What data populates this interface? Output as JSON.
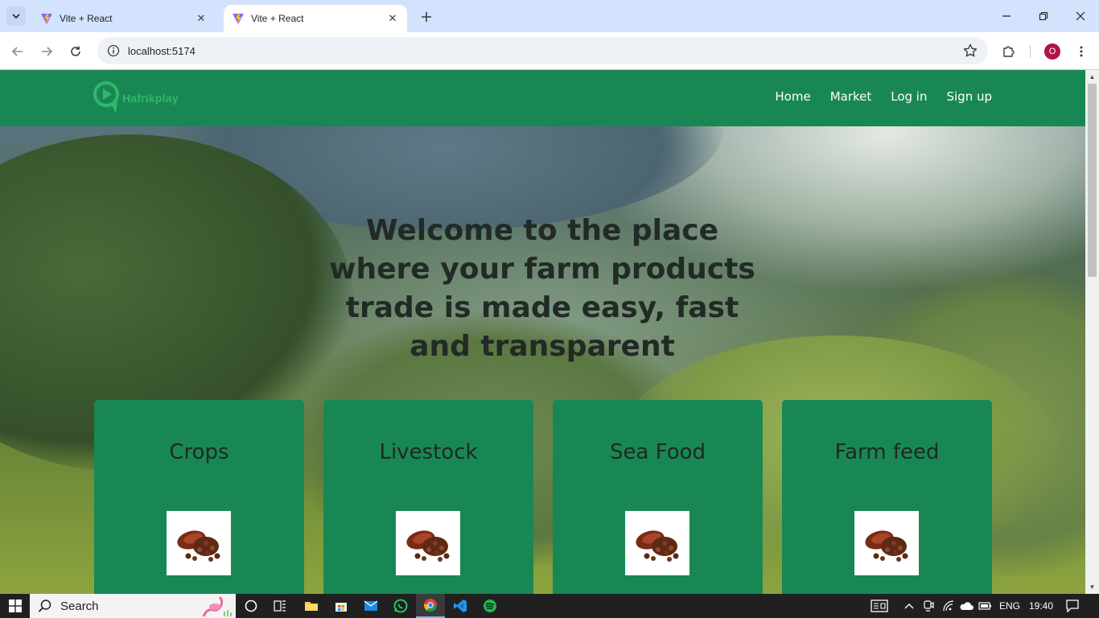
{
  "browser": {
    "tabs": [
      {
        "title": "Vite + React",
        "active": false
      },
      {
        "title": "Vite + React",
        "active": true
      }
    ],
    "url": "localhost:5174",
    "profile_initial": "O"
  },
  "site": {
    "logo_text": "Hafrikplay",
    "nav": [
      "Home",
      "Market",
      "Log in",
      "Sign up"
    ],
    "hero_title": "Welcome to the place where your farm products trade is made easy, fast and transparent",
    "cards": [
      {
        "title": "Crops"
      },
      {
        "title": "Livestock"
      },
      {
        "title": "Sea Food"
      },
      {
        "title": "Farm feed"
      }
    ],
    "colors": {
      "header": "#198754",
      "card": "#198754",
      "logo": "#2fb86a"
    }
  },
  "taskbar": {
    "search_label": "Search",
    "language": "ENG",
    "time": "19:40",
    "apps": [
      "task-view",
      "file-explorer",
      "microsoft-store",
      "mail",
      "whatsapp",
      "chrome",
      "vscode",
      "spotify"
    ]
  }
}
